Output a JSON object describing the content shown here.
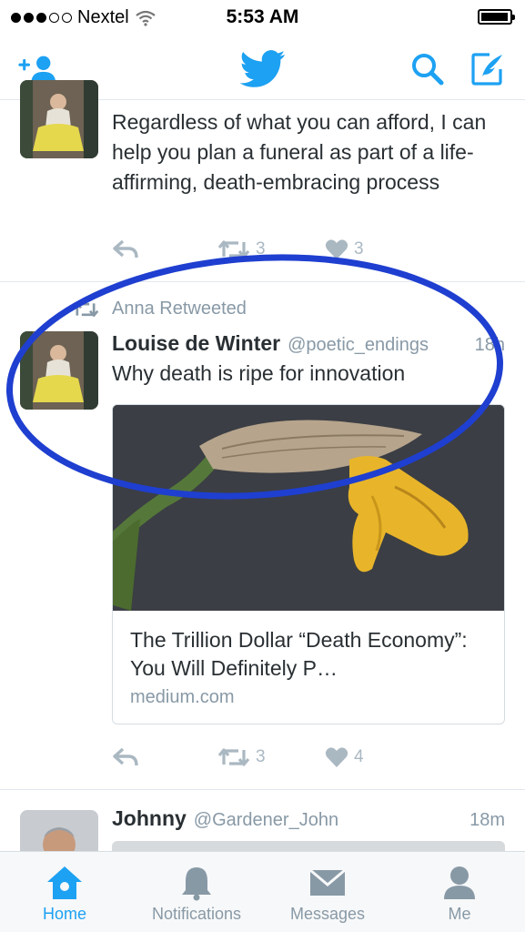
{
  "status": {
    "carrier": "Nextel",
    "time": "5:53 AM"
  },
  "nav": {
    "add_user": "add-user-icon",
    "logo": "twitter-bird-icon",
    "search": "search-icon",
    "compose": "compose-icon"
  },
  "tweets": [
    {
      "text": "Regardless of what you can afford, I can help you plan a funeral as part of a life-affirming, death-embracing process",
      "retweets": "3",
      "likes": "3"
    },
    {
      "retweeted_by": "Anna Retweeted",
      "author": "Louise de Winter",
      "handle": "@poetic_endings",
      "time": "18h",
      "text": "Why death is ripe for innovation",
      "card": {
        "title": "The Trillion Dollar “Death Economy”: You Will Definitely P…",
        "domain": "medium.com"
      },
      "retweets": "3",
      "likes": "4"
    },
    {
      "author": "Johnny",
      "handle": "@Gardener_John",
      "time": "18m"
    }
  ],
  "tabs": [
    {
      "label": "Home",
      "icon": "home-icon",
      "active": true
    },
    {
      "label": "Notifications",
      "icon": "bell-icon",
      "active": false
    },
    {
      "label": "Messages",
      "icon": "envelope-icon",
      "active": false
    },
    {
      "label": "Me",
      "icon": "person-icon",
      "active": false
    }
  ],
  "colors": {
    "accent": "#1da1f2",
    "muted": "#8899a6",
    "oval": "#1f3fd0"
  }
}
